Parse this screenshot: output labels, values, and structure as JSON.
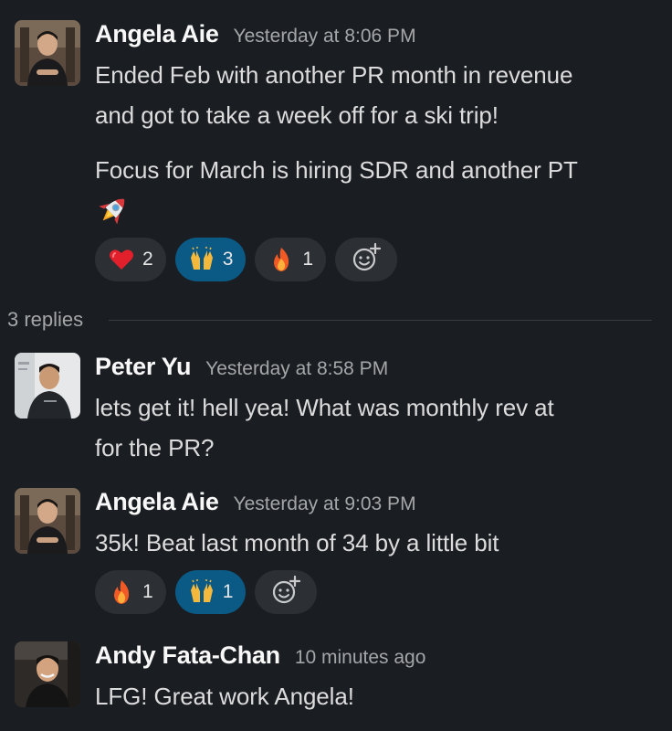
{
  "messages": [
    {
      "author": "Angela Aie",
      "timestamp": "Yesterday at 8:06 PM",
      "avatar_icon": "person-avatar-angela",
      "paragraphs": [
        "Ended Feb with another PR month in revenue\nand got to take a week off for a ski trip!",
        "Focus for March is hiring SDR and another PT"
      ],
      "trailing_emoji": "rocket",
      "reactions": [
        {
          "emoji": "red-heart",
          "count": "2",
          "active": false
        },
        {
          "emoji": "raising-hands",
          "count": "3",
          "active": true
        },
        {
          "emoji": "fire",
          "count": "1",
          "active": false
        }
      ]
    }
  ],
  "replies_label": "3 replies",
  "replies": [
    {
      "author": "Peter Yu",
      "timestamp": "Yesterday at 8:58 PM",
      "avatar_icon": "person-avatar-peter",
      "text": "lets get it! hell yea! What was monthly rev at\nfor the PR?"
    },
    {
      "author": "Angela Aie",
      "timestamp": "Yesterday at 9:03 PM",
      "avatar_icon": "person-avatar-angela",
      "text": "35k! Beat last month of 34 by a little bit",
      "reactions": [
        {
          "emoji": "fire",
          "count": "1",
          "active": false
        },
        {
          "emoji": "raising-hands",
          "count": "1",
          "active": true
        }
      ]
    },
    {
      "author": "Andy Fata-Chan",
      "timestamp": "10 minutes ago",
      "avatar_icon": "person-avatar-andy",
      "text": "LFG! Great work Angela!"
    }
  ],
  "colors": {
    "background": "#1a1d21",
    "active_reaction": "#0b5a86",
    "reaction_bg": "#2c2f33"
  }
}
